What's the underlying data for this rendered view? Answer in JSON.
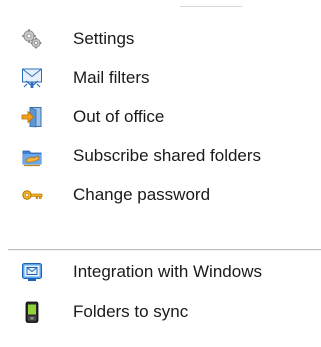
{
  "menu": {
    "items": [
      {
        "label": "Settings",
        "icon": "gears-icon"
      },
      {
        "label": "Mail filters",
        "icon": "mail-filter-icon"
      },
      {
        "label": "Out of office",
        "icon": "out-of-office-icon"
      },
      {
        "label": "Subscribe shared folders",
        "icon": "shared-folder-icon"
      },
      {
        "label": "Change password",
        "icon": "key-icon"
      },
      {
        "label": "Integration with Windows",
        "icon": "windows-integration-icon"
      },
      {
        "label": "Folders to sync",
        "icon": "mobile-device-icon"
      }
    ]
  },
  "colors": {
    "text": "#1a1a1a",
    "divider": "#bdbdbd",
    "accent_blue": "#2f7fd6",
    "accent_orange": "#f0a020"
  }
}
